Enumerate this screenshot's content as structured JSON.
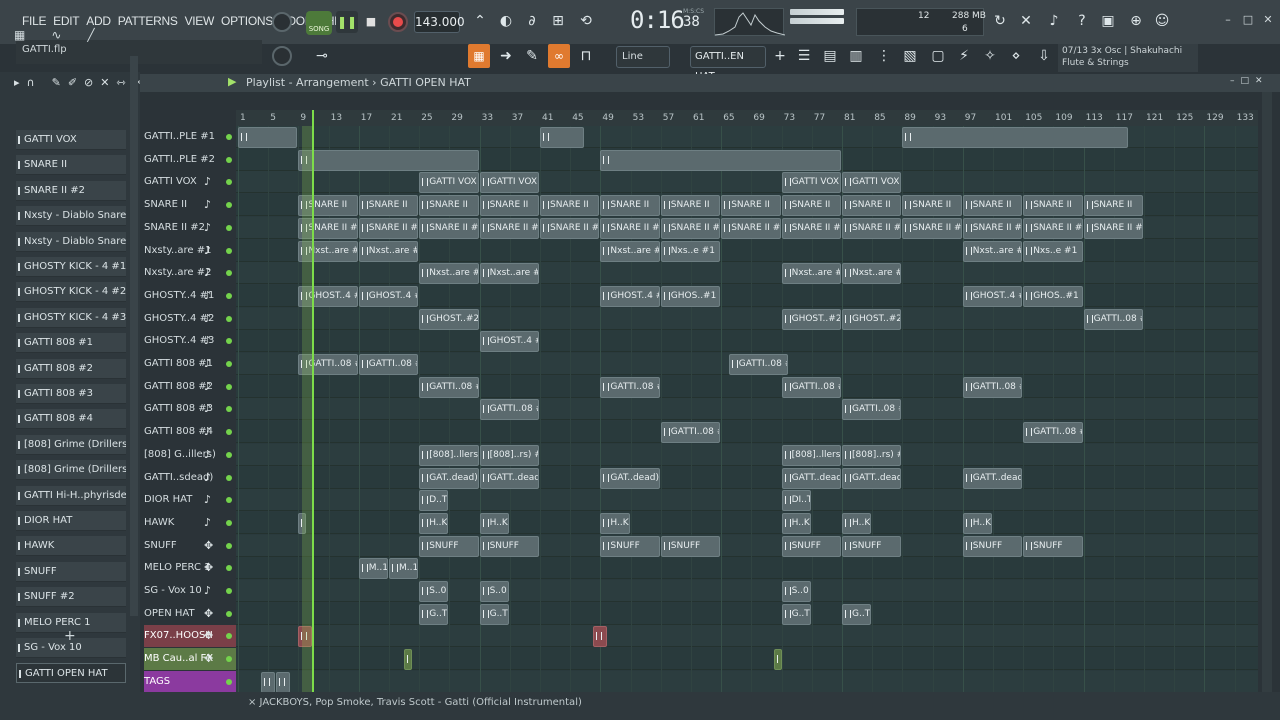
{
  "menu": [
    "FILE",
    "EDIT",
    "ADD",
    "PATTERNS",
    "VIEW",
    "OPTIONS",
    "TOOLS",
    "HELP"
  ],
  "transport": {
    "song_label": "SONG",
    "tempo": "143.000",
    "time_main": "0:16",
    "time_small": "38",
    "time_unit": "M:S:CS"
  },
  "cpu": {
    "cpu": "12",
    "memory": "288 MB",
    "polyphony": "6"
  },
  "file": {
    "name": "GATTI.flp"
  },
  "snap": {
    "mode": "Line"
  },
  "pattern": {
    "selected": "GATTI..EN HAT"
  },
  "hint": {
    "line1": "07/13  3x Osc | Shakuhachi",
    "line2": "Flute & Strings"
  },
  "playlist": {
    "title": "Playlist - Arrangement",
    "pattern": "GATTI OPEN HAT",
    "footer": "× JACKBOYS, Pop Smoke, Travis Scott - Gatti (Official Instrumental)"
  },
  "ruler": [
    "1",
    "5",
    "9",
    "13",
    "17",
    "21",
    "25",
    "29",
    "33",
    "37",
    "41",
    "45",
    "49",
    "53",
    "57",
    "61",
    "65",
    "69",
    "73",
    "77",
    "81",
    "85",
    "89",
    "93",
    "97",
    "101",
    "105",
    "109",
    "113",
    "117",
    "121",
    "125",
    "129",
    "133"
  ],
  "browser": [
    "GATTI VOX",
    "SNARE II",
    "SNARE II #2",
    "Nxsty - Diablo Snare #1",
    "Nxsty - Diablo Snare #2",
    "GHOSTY KICK - 4 #1",
    "GHOSTY KICK - 4 #2",
    "GHOSTY KICK - 4 #3",
    "GATTI 808 #1",
    "GATTI 808 #2",
    "GATTI 808 #3",
    "GATTI 808 #4",
    "[808] Grime (Drillers)",
    "[808] Grime (Drillers) #2",
    "GATTI Hi-H..phyrisdead)",
    "DIOR HAT",
    "HAWK",
    "SNUFF",
    "SNUFF #2",
    "MELO PERC 1",
    "SG - Vox 10",
    "GATTI OPEN HAT"
  ],
  "tracks": [
    {
      "name": "GATTI..PLE #1",
      "icon": "dot"
    },
    {
      "name": "GATTI..PLE #2",
      "icon": "dot"
    },
    {
      "name": "GATTI VOX",
      "icon": "note"
    },
    {
      "name": "SNARE II",
      "icon": "note"
    },
    {
      "name": "SNARE II #2",
      "icon": "note"
    },
    {
      "name": "Nxsty..are #1",
      "icon": "note"
    },
    {
      "name": "Nxsty..are #2",
      "icon": "note"
    },
    {
      "name": "GHOSTY..4 #1",
      "icon": "note"
    },
    {
      "name": "GHOSTY..4 #2",
      "icon": "note"
    },
    {
      "name": "GHOSTY..4 #3",
      "icon": "note"
    },
    {
      "name": "GATTI 808 #1",
      "icon": "note"
    },
    {
      "name": "GATTI 808 #2",
      "icon": "note"
    },
    {
      "name": "GATTI 808 #3",
      "icon": "note"
    },
    {
      "name": "GATTI 808 #4",
      "icon": "note"
    },
    {
      "name": "[808] G..illers)",
      "icon": "note"
    },
    {
      "name": "GATTI..sdead)",
      "icon": "note"
    },
    {
      "name": "DIOR HAT",
      "icon": "note"
    },
    {
      "name": "HAWK",
      "icon": "note"
    },
    {
      "name": "SNUFF",
      "icon": "cross"
    },
    {
      "name": "MELO PERC 1",
      "icon": "cross"
    },
    {
      "name": "SG - Vox 10",
      "icon": "note"
    },
    {
      "name": "OPEN HAT",
      "icon": "cross"
    },
    {
      "name": "FX07..HOOSH",
      "icon": "cross",
      "style": "red"
    },
    {
      "name": "MB Cau..al FX",
      "icon": "cross",
      "style": "green"
    },
    {
      "name": "TAGS",
      "icon": "dot",
      "style": "purple"
    }
  ],
  "clips": [
    {
      "row": 2,
      "bar": 25,
      "len": 8,
      "label": "GATTI VOX"
    },
    {
      "row": 2,
      "bar": 33,
      "len": 8,
      "label": "GATTI VOX"
    },
    {
      "row": 2,
      "bar": 73,
      "len": 8,
      "label": "GATTI VOX"
    },
    {
      "row": 2,
      "bar": 81,
      "len": 8,
      "label": "GATTI VOX"
    },
    {
      "row": 3,
      "bar": 9,
      "len": 8,
      "label": "SNARE II"
    },
    {
      "row": 3,
      "bar": 17,
      "len": 8,
      "label": "SNARE II"
    },
    {
      "row": 3,
      "bar": 25,
      "len": 8,
      "label": "SNARE II"
    },
    {
      "row": 3,
      "bar": 33,
      "len": 8,
      "label": "SNARE II"
    },
    {
      "row": 3,
      "bar": 41,
      "len": 8,
      "label": "SNARE II"
    },
    {
      "row": 3,
      "bar": 49,
      "len": 8,
      "label": "SNARE II"
    },
    {
      "row": 3,
      "bar": 57,
      "len": 8,
      "label": "SNARE II"
    },
    {
      "row": 3,
      "bar": 65,
      "len": 8,
      "label": "SNARE II"
    },
    {
      "row": 3,
      "bar": 73,
      "len": 8,
      "label": "SNARE II"
    },
    {
      "row": 3,
      "bar": 81,
      "len": 8,
      "label": "SNARE II"
    },
    {
      "row": 3,
      "bar": 89,
      "len": 8,
      "label": "SNARE II"
    },
    {
      "row": 3,
      "bar": 97,
      "len": 8,
      "label": "SNARE II"
    },
    {
      "row": 3,
      "bar": 105,
      "len": 8,
      "label": "SNARE II"
    },
    {
      "row": 3,
      "bar": 113,
      "len": 8,
      "label": "SNARE II"
    },
    {
      "row": 4,
      "bar": 9,
      "len": 8,
      "label": "SNARE II #2"
    },
    {
      "row": 4,
      "bar": 17,
      "len": 8,
      "label": "SNARE II #2"
    },
    {
      "row": 4,
      "bar": 25,
      "len": 8,
      "label": "SNARE II #2"
    },
    {
      "row": 4,
      "bar": 33,
      "len": 8,
      "label": "SNARE II #2"
    },
    {
      "row": 4,
      "bar": 41,
      "len": 8,
      "label": "SNARE II #2"
    },
    {
      "row": 4,
      "bar": 49,
      "len": 8,
      "label": "SNARE II #2"
    },
    {
      "row": 4,
      "bar": 57,
      "len": 8,
      "label": "SNARE II #2"
    },
    {
      "row": 4,
      "bar": 65,
      "len": 8,
      "label": "SNARE II #2"
    },
    {
      "row": 4,
      "bar": 73,
      "len": 8,
      "label": "SNARE II #2"
    },
    {
      "row": 4,
      "bar": 81,
      "len": 8,
      "label": "SNARE II #2"
    },
    {
      "row": 4,
      "bar": 89,
      "len": 8,
      "label": "SNARE II #2"
    },
    {
      "row": 4,
      "bar": 97,
      "len": 8,
      "label": "SNARE II #2"
    },
    {
      "row": 4,
      "bar": 105,
      "len": 8,
      "label": "SNARE II #2"
    },
    {
      "row": 4,
      "bar": 113,
      "len": 8,
      "label": "SNARE II #2"
    },
    {
      "row": 5,
      "bar": 9,
      "len": 8,
      "label": "Nxst..are #1"
    },
    {
      "row": 5,
      "bar": 17,
      "len": 8,
      "label": "Nxst..are #1"
    },
    {
      "row": 5,
      "bar": 49,
      "len": 8,
      "label": "Nxst..are #1"
    },
    {
      "row": 5,
      "bar": 57,
      "len": 8,
      "label": "Nxs..e #1"
    },
    {
      "row": 5,
      "bar": 97,
      "len": 8,
      "label": "Nxst..are #1"
    },
    {
      "row": 5,
      "bar": 105,
      "len": 8,
      "label": "Nxs..e #1"
    },
    {
      "row": 6,
      "bar": 25,
      "len": 8,
      "label": "Nxst..are #2"
    },
    {
      "row": 6,
      "bar": 33,
      "len": 8,
      "label": "Nxst..are #2"
    },
    {
      "row": 6,
      "bar": 73,
      "len": 8,
      "label": "Nxst..are #2"
    },
    {
      "row": 6,
      "bar": 81,
      "len": 8,
      "label": "Nxst..are #2"
    },
    {
      "row": 7,
      "bar": 9,
      "len": 8,
      "label": "GHOST..4 #1"
    },
    {
      "row": 7,
      "bar": 17,
      "len": 8,
      "label": "GHOST..4 #1"
    },
    {
      "row": 7,
      "bar": 49,
      "len": 8,
      "label": "GHOST..4 #1"
    },
    {
      "row": 7,
      "bar": 57,
      "len": 8,
      "label": "GHOS..#1"
    },
    {
      "row": 7,
      "bar": 97,
      "len": 8,
      "label": "GHOST..4 #1"
    },
    {
      "row": 7,
      "bar": 105,
      "len": 8,
      "label": "GHOS..#1"
    },
    {
      "row": 8,
      "bar": 25,
      "len": 8,
      "label": "GHOST..#2"
    },
    {
      "row": 8,
      "bar": 73,
      "len": 8,
      "label": "GHOST..#2"
    },
    {
      "row": 8,
      "bar": 81,
      "len": 8,
      "label": "GHOST..#2"
    },
    {
      "row": 8,
      "bar": 113,
      "len": 8,
      "label": "GATTI..08 #1"
    },
    {
      "row": 9,
      "bar": 33,
      "len": 8,
      "label": "GHOST..4 #3"
    },
    {
      "row": 10,
      "bar": 9,
      "len": 8,
      "label": "GATTI..08 #1"
    },
    {
      "row": 10,
      "bar": 17,
      "len": 8,
      "label": "GATTI..08 #1"
    },
    {
      "row": 10,
      "bar": 66,
      "len": 8,
      "label": "GATTI..08 #1"
    },
    {
      "row": 11,
      "bar": 25,
      "len": 8,
      "label": "GATTI..08 #2"
    },
    {
      "row": 11,
      "bar": 49,
      "len": 8,
      "label": "GATTI..08 #2"
    },
    {
      "row": 11,
      "bar": 73,
      "len": 8,
      "label": "GATTI..08 #2"
    },
    {
      "row": 11,
      "bar": 97,
      "len": 8,
      "label": "GATTI..08 #2"
    },
    {
      "row": 12,
      "bar": 33,
      "len": 8,
      "label": "GATTI..08 #3"
    },
    {
      "row": 12,
      "bar": 81,
      "len": 8,
      "label": "GATTI..08 #3"
    },
    {
      "row": 13,
      "bar": 57,
      "len": 8,
      "label": "GATTI..08 #4"
    },
    {
      "row": 13,
      "bar": 105,
      "len": 8,
      "label": "GATTI..08 #4"
    },
    {
      "row": 14,
      "bar": 25,
      "len": 8,
      "label": "[808]..llers)"
    },
    {
      "row": 14,
      "bar": 33,
      "len": 8,
      "label": "[808]..rs) #2"
    },
    {
      "row": 14,
      "bar": 73,
      "len": 8,
      "label": "[808]..llers)"
    },
    {
      "row": 14,
      "bar": 81,
      "len": 8,
      "label": "[808]..rs) #2"
    },
    {
      "row": 15,
      "bar": 25,
      "len": 8,
      "label": "GAT..dead)"
    },
    {
      "row": 15,
      "bar": 33,
      "len": 8,
      "label": "GATT..dead)"
    },
    {
      "row": 15,
      "bar": 49,
      "len": 8,
      "label": "GAT..dead)"
    },
    {
      "row": 15,
      "bar": 73,
      "len": 8,
      "label": "GATT..dead)"
    },
    {
      "row": 15,
      "bar": 81,
      "len": 8,
      "label": "GATT..dead)"
    },
    {
      "row": 15,
      "bar": 97,
      "len": 8,
      "label": "GATT..dead)"
    },
    {
      "row": 16,
      "bar": 25,
      "len": 4,
      "label": "D..T"
    },
    {
      "row": 16,
      "bar": 73,
      "len": 4,
      "label": "DI..T"
    },
    {
      "row": 17,
      "bar": 9,
      "len": 1,
      "label": ""
    },
    {
      "row": 17,
      "bar": 25,
      "len": 4,
      "label": "H..K"
    },
    {
      "row": 17,
      "bar": 33,
      "len": 4,
      "label": "H..K"
    },
    {
      "row": 17,
      "bar": 49,
      "len": 4,
      "label": "H..K"
    },
    {
      "row": 17,
      "bar": 73,
      "len": 4,
      "label": "H..K"
    },
    {
      "row": 17,
      "bar": 81,
      "len": 4,
      "label": "H..K"
    },
    {
      "row": 17,
      "bar": 97,
      "len": 4,
      "label": "H..K"
    },
    {
      "row": 18,
      "bar": 25,
      "len": 8,
      "label": "SNUFF"
    },
    {
      "row": 18,
      "bar": 33,
      "len": 8,
      "label": "SNUFF"
    },
    {
      "row": 18,
      "bar": 49,
      "len": 8,
      "label": "SNUFF"
    },
    {
      "row": 18,
      "bar": 57,
      "len": 8,
      "label": "SNUFF"
    },
    {
      "row": 18,
      "bar": 73,
      "len": 8,
      "label": "SNUFF"
    },
    {
      "row": 18,
      "bar": 81,
      "len": 8,
      "label": "SNUFF"
    },
    {
      "row": 18,
      "bar": 97,
      "len": 8,
      "label": "SNUFF"
    },
    {
      "row": 18,
      "bar": 105,
      "len": 8,
      "label": "SNUFF"
    },
    {
      "row": 19,
      "bar": 17,
      "len": 4,
      "label": "M..1"
    },
    {
      "row": 19,
      "bar": 21,
      "len": 4,
      "label": "M..1"
    },
    {
      "row": 20,
      "bar": 25,
      "len": 4,
      "label": "S..0"
    },
    {
      "row": 20,
      "bar": 33,
      "len": 4,
      "label": "S..0"
    },
    {
      "row": 20,
      "bar": 73,
      "len": 4,
      "label": "S..0"
    },
    {
      "row": 21,
      "bar": 25,
      "len": 4,
      "label": "G..T"
    },
    {
      "row": 21,
      "bar": 33,
      "len": 4,
      "label": "G..T"
    },
    {
      "row": 21,
      "bar": 73,
      "len": 4,
      "label": "G..T"
    },
    {
      "row": 21,
      "bar": 81,
      "len": 4,
      "label": "G..T"
    },
    {
      "row": 22,
      "bar": 9,
      "len": 2,
      "label": "",
      "style": "red"
    },
    {
      "row": 22,
      "bar": 48,
      "len": 2,
      "label": "",
      "style": "red"
    },
    {
      "row": 23,
      "bar": 23,
      "len": 1,
      "label": "",
      "style": "green"
    },
    {
      "row": 23,
      "bar": 72,
      "len": 1,
      "label": "",
      "style": "green"
    },
    {
      "row": 24,
      "bar": 4,
      "len": 2,
      "label": ""
    },
    {
      "row": 24,
      "bar": 6,
      "len": 2,
      "label": ""
    }
  ]
}
